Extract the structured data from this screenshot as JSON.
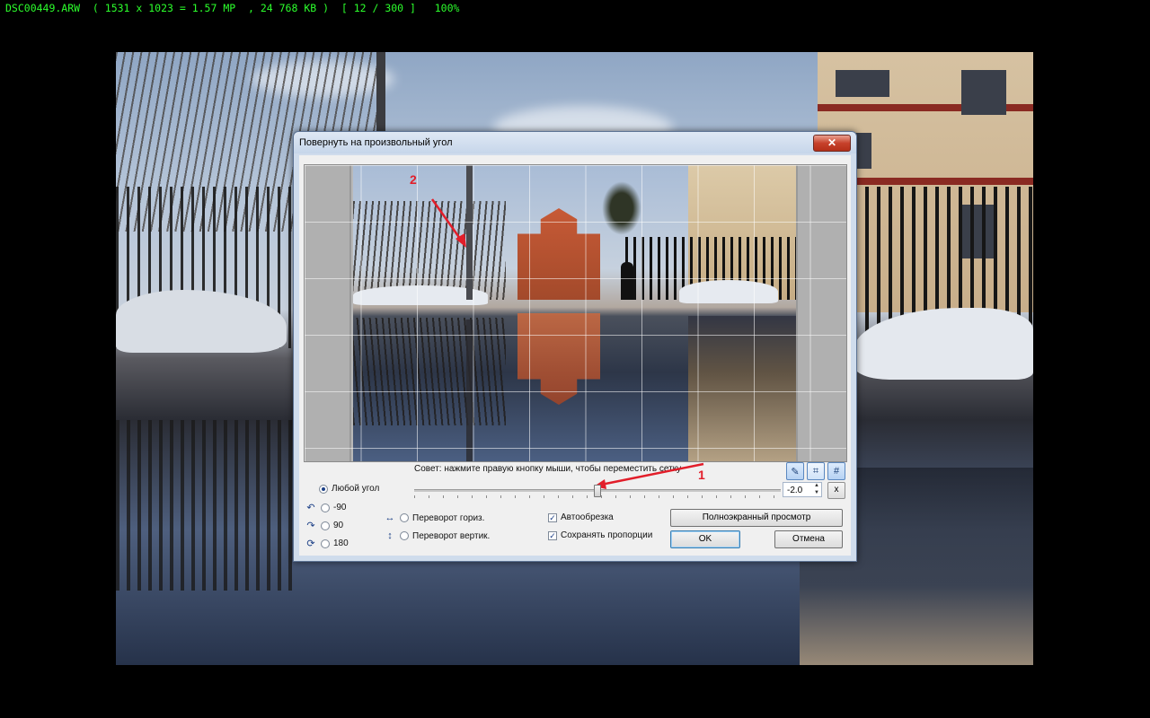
{
  "status": {
    "text": "DSC00449.ARW  ( 1531 x 1023 = 1.57 MP  , 24 768 KB )  [ 12 / 300 ]   100%"
  },
  "dialog": {
    "title": "Повернуть на произвольный угол",
    "close_label": "✕",
    "hint": "Совет: нажмите правую кнопку мыши, чтобы переместить сетку",
    "tools": [
      {
        "icon": "pencil-icon",
        "glyph": "✎"
      },
      {
        "icon": "crop-icon",
        "glyph": "⌗"
      },
      {
        "icon": "grid-icon",
        "glyph": "#"
      }
    ],
    "angle_value": "-2.0",
    "slider_position_fraction": 0.49,
    "reset_label": "x",
    "options": {
      "any_angle": "Любой угол",
      "rot_minus90": "-90",
      "rot_90": "90",
      "rot_180": "180",
      "flip_h": "Переворот гориз.",
      "flip_v": "Переворот вертик.",
      "autocrop": "Автообрезка",
      "keep_ratio": "Сохранять пропорции"
    },
    "buttons": {
      "fullscreen": "Полноэкранный просмотр",
      "ok": "OK",
      "cancel": "Отмена"
    },
    "annotations": {
      "one": "1",
      "two": "2",
      "color": "#e21e2a"
    }
  }
}
